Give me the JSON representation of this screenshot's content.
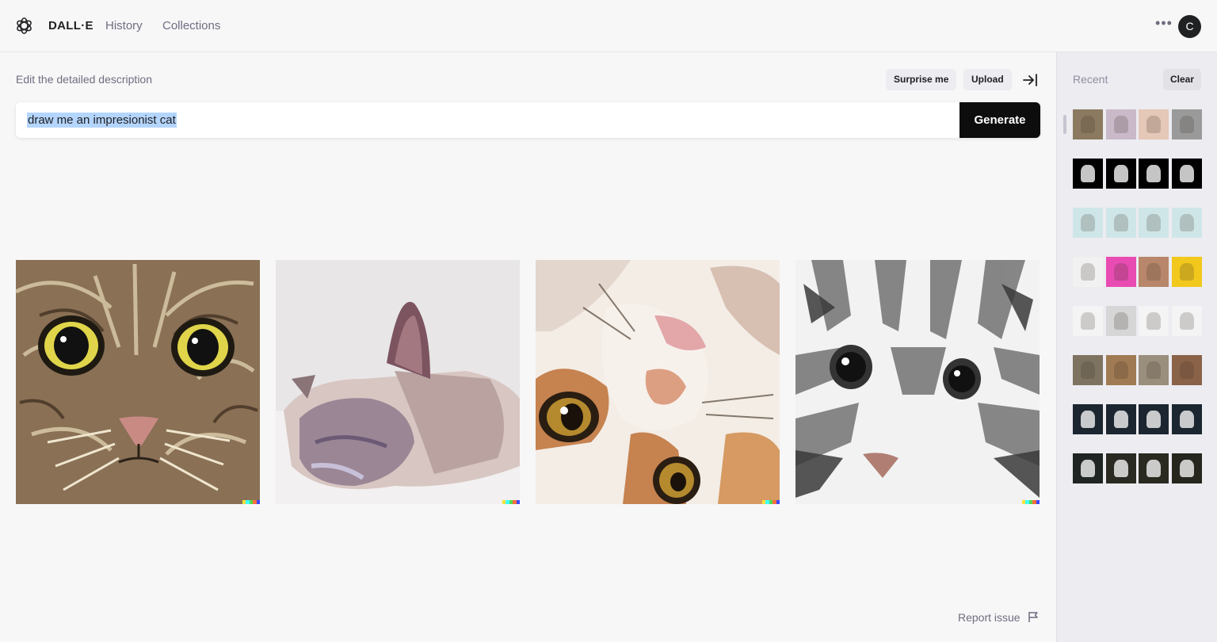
{
  "header": {
    "brand": "DALL·E",
    "nav": [
      "History",
      "Collections"
    ],
    "avatar_initial": "C",
    "icons": [
      "openai-logo-icon",
      "more-horizontal-icon"
    ]
  },
  "editor": {
    "label": "Edit the detailed description",
    "surprise_label": "Surprise me",
    "upload_label": "Upload",
    "prompt_value": "draw me an impresionist cat",
    "generate_label": "Generate"
  },
  "results": [
    {
      "subject": "tabby-cat-face-painting",
      "palette": [
        "#8a7055",
        "#d8c9a8",
        "#2b2118",
        "#e0d54a"
      ]
    },
    {
      "subject": "sleeping-siamese-cat-painting",
      "palette": [
        "#e8e6e7",
        "#c9b6b4",
        "#7b6470",
        "#a58d8a"
      ]
    },
    {
      "subject": "orange-white-cat-painting",
      "palette": [
        "#f3ede6",
        "#c6824f",
        "#3a2a1a",
        "#b58a2e"
      ]
    },
    {
      "subject": "grey-tabby-cat-painting",
      "palette": [
        "#f2f2f2",
        "#8a8a8a",
        "#3a3a3a",
        "#111111"
      ]
    }
  ],
  "footer": {
    "report_label": "Report issue"
  },
  "sidebar": {
    "recent_label": "Recent",
    "clear_label": "Clear",
    "rows": [
      {
        "colors": [
          "#8b7a60",
          "#c9b9c9",
          "#e5c8b8",
          "#9a9a9a"
        ],
        "dark": false
      },
      {
        "colors": [
          "#000000",
          "#000000",
          "#000000",
          "#000000"
        ],
        "dark": true
      },
      {
        "colors": [
          "#cfe6e8",
          "#cfe6e8",
          "#cfe6e8",
          "#cfe6e8"
        ],
        "dark": false
      },
      {
        "colors": [
          "#f1f1f1",
          "#e84bb1",
          "#b8866a",
          "#f2c81c"
        ],
        "dark": false
      },
      {
        "colors": [
          "#f4f4f4",
          "#d6d6d6",
          "#f4f4f4",
          "#f4f4f4"
        ],
        "dark": false
      },
      {
        "colors": [
          "#7d7360",
          "#a07a52",
          "#9a8e7c",
          "#8a6248"
        ],
        "dark": false
      },
      {
        "colors": [
          "#1c2630",
          "#1c2630",
          "#1c2630",
          "#1c2630"
        ],
        "dark": true
      },
      {
        "colors": [
          "#1e2522",
          "#2a2a22",
          "#2b2a20",
          "#26261f"
        ],
        "dark": true
      }
    ]
  },
  "colors": {
    "background": "#f7f7f8",
    "sidebar": "#ececf1",
    "primary_button": "#0d0d0d",
    "selection": "#b4d5fe"
  }
}
